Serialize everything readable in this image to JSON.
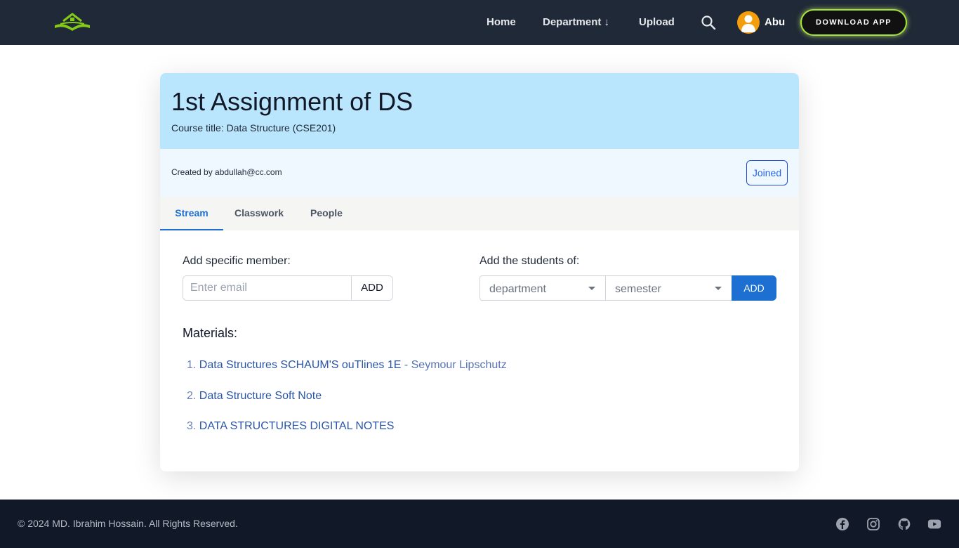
{
  "nav": {
    "home": "Home",
    "department": "Department ↓",
    "upload": "Upload",
    "user_name": "Abu",
    "download_app": "DOWNLOAD APP"
  },
  "header": {
    "title": "1st Assignment of DS",
    "course_title": "Course title: Data Structure (CSE201)"
  },
  "meta": {
    "created_by": "Created by abdullah@cc.com",
    "joined_label": "Joined"
  },
  "tabs": [
    {
      "label": "Stream",
      "active": true
    },
    {
      "label": "Classwork",
      "active": false
    },
    {
      "label": "People",
      "active": false
    }
  ],
  "add_member": {
    "label": "Add specific member:",
    "placeholder": "Enter email",
    "button": "ADD"
  },
  "add_students": {
    "label": "Add the students of:",
    "department_value": "department",
    "semester_value": "semester",
    "button": "ADD"
  },
  "materials": {
    "title": "Materials:",
    "items": [
      {
        "num": "1.",
        "title": "Data Structures SCHAUM'S ouTlines 1E",
        "author": " - Seymour Lipschutz"
      },
      {
        "num": "2.",
        "title": "Data Structure Soft Note",
        "author": ""
      },
      {
        "num": "3.",
        "title": "DATA STRUCTURES DIGITAL NOTES",
        "author": ""
      }
    ]
  },
  "footer": {
    "copyright": "© 2024 MD. Ibrahim Hossain. All Rights Reserved."
  },
  "colors": {
    "navbar": "#1f2937",
    "header_bg": "#bae6fd",
    "accent": "#1d6fd1",
    "footer": "#111827"
  },
  "icons": [
    "logo-icon",
    "search-icon",
    "avatar-icon",
    "facebook-icon",
    "instagram-icon",
    "github-icon",
    "youtube-icon",
    "caret-down-icon"
  ]
}
